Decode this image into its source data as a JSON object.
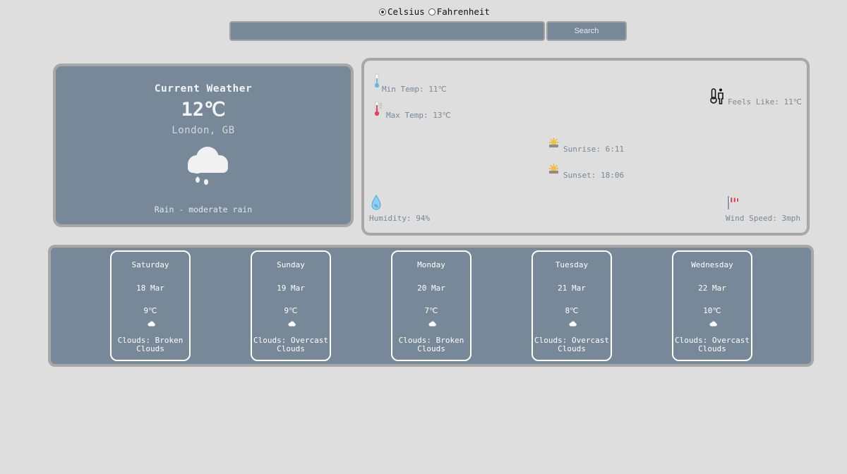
{
  "units": {
    "celsius": "Celsius",
    "fahrenheit": "Fahrenheit",
    "selected": "Celsius"
  },
  "search": {
    "value": "",
    "placeholder": "",
    "button": "Search"
  },
  "current": {
    "title": "Current Weather",
    "temp": "12℃",
    "location": "London, GB",
    "icon": "rain-cloud-icon",
    "description": "Rain - moderate rain"
  },
  "details": {
    "min_temp": "Min Temp: 11℃",
    "max_temp": "Max Temp: 13℃",
    "feels_like": "Feels Like: 11℃",
    "sunrise": "Sunrise: 6:11",
    "sunset": "Sunset: 18:06",
    "humidity": "Humidity: 94%",
    "wind_speed": "Wind Speed: 3mph"
  },
  "forecast": [
    {
      "day": "Saturday",
      "date": "18 Mar",
      "temp": "9℃",
      "desc1": "Clouds: Broken",
      "desc2": "Clouds"
    },
    {
      "day": "Sunday",
      "date": "19 Mar",
      "temp": "9℃",
      "desc1": "Clouds: Overcast",
      "desc2": "Clouds"
    },
    {
      "day": "Monday",
      "date": "20 Mar",
      "temp": "7℃",
      "desc1": "Clouds: Broken",
      "desc2": "Clouds"
    },
    {
      "day": "Tuesday",
      "date": "21 Mar",
      "temp": "8℃",
      "desc1": "Clouds: Overcast",
      "desc2": "Clouds"
    },
    {
      "day": "Wednesday",
      "date": "22 Mar",
      "temp": "10℃",
      "desc1": "Clouds: Overcast",
      "desc2": "Clouds"
    }
  ],
  "colors": {
    "panel": "#778899",
    "page": "#dedede",
    "border": "#a7a7a7"
  }
}
